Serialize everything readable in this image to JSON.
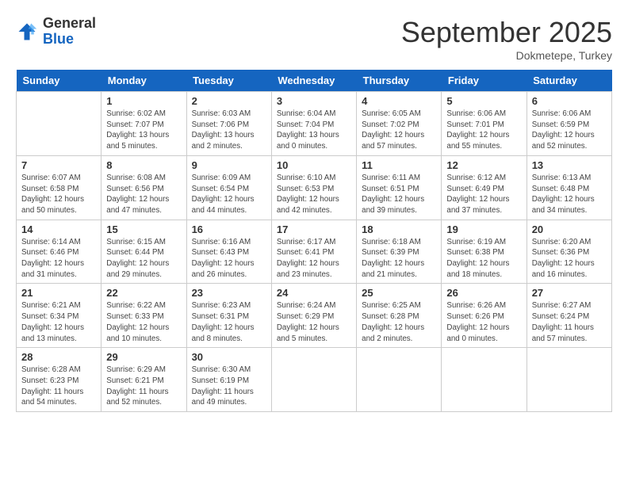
{
  "logo": {
    "general": "General",
    "blue": "Blue"
  },
  "title": "September 2025",
  "subtitle": "Dokmetepe, Turkey",
  "headers": [
    "Sunday",
    "Monday",
    "Tuesday",
    "Wednesday",
    "Thursday",
    "Friday",
    "Saturday"
  ],
  "weeks": [
    [
      {
        "date": "",
        "sunrise": "",
        "sunset": "",
        "daylight": ""
      },
      {
        "date": "1",
        "sunrise": "Sunrise: 6:02 AM",
        "sunset": "Sunset: 7:07 PM",
        "daylight": "Daylight: 13 hours and 5 minutes."
      },
      {
        "date": "2",
        "sunrise": "Sunrise: 6:03 AM",
        "sunset": "Sunset: 7:06 PM",
        "daylight": "Daylight: 13 hours and 2 minutes."
      },
      {
        "date": "3",
        "sunrise": "Sunrise: 6:04 AM",
        "sunset": "Sunset: 7:04 PM",
        "daylight": "Daylight: 13 hours and 0 minutes."
      },
      {
        "date": "4",
        "sunrise": "Sunrise: 6:05 AM",
        "sunset": "Sunset: 7:02 PM",
        "daylight": "Daylight: 12 hours and 57 minutes."
      },
      {
        "date": "5",
        "sunrise": "Sunrise: 6:06 AM",
        "sunset": "Sunset: 7:01 PM",
        "daylight": "Daylight: 12 hours and 55 minutes."
      },
      {
        "date": "6",
        "sunrise": "Sunrise: 6:06 AM",
        "sunset": "Sunset: 6:59 PM",
        "daylight": "Daylight: 12 hours and 52 minutes."
      }
    ],
    [
      {
        "date": "7",
        "sunrise": "Sunrise: 6:07 AM",
        "sunset": "Sunset: 6:58 PM",
        "daylight": "Daylight: 12 hours and 50 minutes."
      },
      {
        "date": "8",
        "sunrise": "Sunrise: 6:08 AM",
        "sunset": "Sunset: 6:56 PM",
        "daylight": "Daylight: 12 hours and 47 minutes."
      },
      {
        "date": "9",
        "sunrise": "Sunrise: 6:09 AM",
        "sunset": "Sunset: 6:54 PM",
        "daylight": "Daylight: 12 hours and 44 minutes."
      },
      {
        "date": "10",
        "sunrise": "Sunrise: 6:10 AM",
        "sunset": "Sunset: 6:53 PM",
        "daylight": "Daylight: 12 hours and 42 minutes."
      },
      {
        "date": "11",
        "sunrise": "Sunrise: 6:11 AM",
        "sunset": "Sunset: 6:51 PM",
        "daylight": "Daylight: 12 hours and 39 minutes."
      },
      {
        "date": "12",
        "sunrise": "Sunrise: 6:12 AM",
        "sunset": "Sunset: 6:49 PM",
        "daylight": "Daylight: 12 hours and 37 minutes."
      },
      {
        "date": "13",
        "sunrise": "Sunrise: 6:13 AM",
        "sunset": "Sunset: 6:48 PM",
        "daylight": "Daylight: 12 hours and 34 minutes."
      }
    ],
    [
      {
        "date": "14",
        "sunrise": "Sunrise: 6:14 AM",
        "sunset": "Sunset: 6:46 PM",
        "daylight": "Daylight: 12 hours and 31 minutes."
      },
      {
        "date": "15",
        "sunrise": "Sunrise: 6:15 AM",
        "sunset": "Sunset: 6:44 PM",
        "daylight": "Daylight: 12 hours and 29 minutes."
      },
      {
        "date": "16",
        "sunrise": "Sunrise: 6:16 AM",
        "sunset": "Sunset: 6:43 PM",
        "daylight": "Daylight: 12 hours and 26 minutes."
      },
      {
        "date": "17",
        "sunrise": "Sunrise: 6:17 AM",
        "sunset": "Sunset: 6:41 PM",
        "daylight": "Daylight: 12 hours and 23 minutes."
      },
      {
        "date": "18",
        "sunrise": "Sunrise: 6:18 AM",
        "sunset": "Sunset: 6:39 PM",
        "daylight": "Daylight: 12 hours and 21 minutes."
      },
      {
        "date": "19",
        "sunrise": "Sunrise: 6:19 AM",
        "sunset": "Sunset: 6:38 PM",
        "daylight": "Daylight: 12 hours and 18 minutes."
      },
      {
        "date": "20",
        "sunrise": "Sunrise: 6:20 AM",
        "sunset": "Sunset: 6:36 PM",
        "daylight": "Daylight: 12 hours and 16 minutes."
      }
    ],
    [
      {
        "date": "21",
        "sunrise": "Sunrise: 6:21 AM",
        "sunset": "Sunset: 6:34 PM",
        "daylight": "Daylight: 12 hours and 13 minutes."
      },
      {
        "date": "22",
        "sunrise": "Sunrise: 6:22 AM",
        "sunset": "Sunset: 6:33 PM",
        "daylight": "Daylight: 12 hours and 10 minutes."
      },
      {
        "date": "23",
        "sunrise": "Sunrise: 6:23 AM",
        "sunset": "Sunset: 6:31 PM",
        "daylight": "Daylight: 12 hours and 8 minutes."
      },
      {
        "date": "24",
        "sunrise": "Sunrise: 6:24 AM",
        "sunset": "Sunset: 6:29 PM",
        "daylight": "Daylight: 12 hours and 5 minutes."
      },
      {
        "date": "25",
        "sunrise": "Sunrise: 6:25 AM",
        "sunset": "Sunset: 6:28 PM",
        "daylight": "Daylight: 12 hours and 2 minutes."
      },
      {
        "date": "26",
        "sunrise": "Sunrise: 6:26 AM",
        "sunset": "Sunset: 6:26 PM",
        "daylight": "Daylight: 12 hours and 0 minutes."
      },
      {
        "date": "27",
        "sunrise": "Sunrise: 6:27 AM",
        "sunset": "Sunset: 6:24 PM",
        "daylight": "Daylight: 11 hours and 57 minutes."
      }
    ],
    [
      {
        "date": "28",
        "sunrise": "Sunrise: 6:28 AM",
        "sunset": "Sunset: 6:23 PM",
        "daylight": "Daylight: 11 hours and 54 minutes."
      },
      {
        "date": "29",
        "sunrise": "Sunrise: 6:29 AM",
        "sunset": "Sunset: 6:21 PM",
        "daylight": "Daylight: 11 hours and 52 minutes."
      },
      {
        "date": "30",
        "sunrise": "Sunrise: 6:30 AM",
        "sunset": "Sunset: 6:19 PM",
        "daylight": "Daylight: 11 hours and 49 minutes."
      },
      {
        "date": "",
        "sunrise": "",
        "sunset": "",
        "daylight": ""
      },
      {
        "date": "",
        "sunrise": "",
        "sunset": "",
        "daylight": ""
      },
      {
        "date": "",
        "sunrise": "",
        "sunset": "",
        "daylight": ""
      },
      {
        "date": "",
        "sunrise": "",
        "sunset": "",
        "daylight": ""
      }
    ]
  ]
}
